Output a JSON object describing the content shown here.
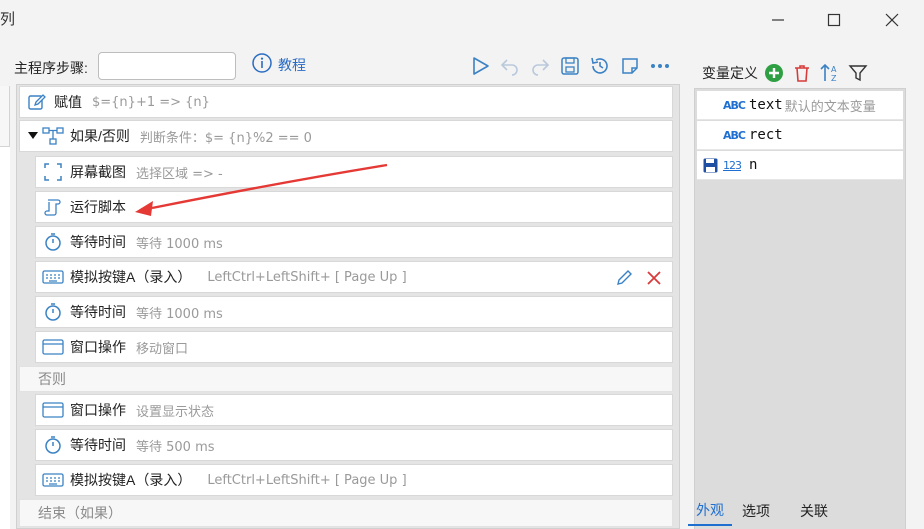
{
  "window": {
    "title_fragment": "列"
  },
  "toolbar": {
    "step_label": "主程序步骤:",
    "step_value": "",
    "tutorial_label": "教程"
  },
  "flow": {
    "rows": [
      {
        "name": "赋值",
        "desc": "$={n}+1 => {n}"
      },
      {
        "name": "如果/否则",
        "desc": "判断条件：$= {n}%2 == 0"
      },
      {
        "name": "屏幕截图",
        "desc": "选择区域 => -"
      },
      {
        "name": "运行脚本",
        "desc": ""
      },
      {
        "name": "等待时间",
        "desc": "等待 1000 ms"
      },
      {
        "name": "模拟按键A（录入）",
        "desc": "LeftCtrl+LeftShift+ [ Page Up ]"
      },
      {
        "name": "等待时间",
        "desc": "等待 1000 ms"
      },
      {
        "name": "窗口操作",
        "desc": "移动窗口"
      },
      {
        "name": "否则",
        "desc": ""
      },
      {
        "name": "窗口操作",
        "desc": "设置显示状态"
      },
      {
        "name": "等待时间",
        "desc": "等待 500 ms"
      },
      {
        "name": "模拟按键A（录入）",
        "desc": "LeftCtrl+LeftShift+ [ Page Up ]"
      },
      {
        "name": "结束（如果）",
        "desc": ""
      }
    ]
  },
  "variables": {
    "title": "变量定义",
    "items": [
      {
        "type_badge": "ABC",
        "name": "text",
        "desc": "默认的文本变量"
      },
      {
        "type_badge": "ABC",
        "name": "rect",
        "desc": ""
      },
      {
        "type_badge": "123",
        "name": "n",
        "desc": ""
      }
    ]
  },
  "tabs": [
    "外观",
    "选项",
    "关联"
  ],
  "colors": {
    "accent": "#1f6fd1",
    "add": "#2ea043",
    "delete": "#d83b3b",
    "arrow": "#e53935"
  }
}
